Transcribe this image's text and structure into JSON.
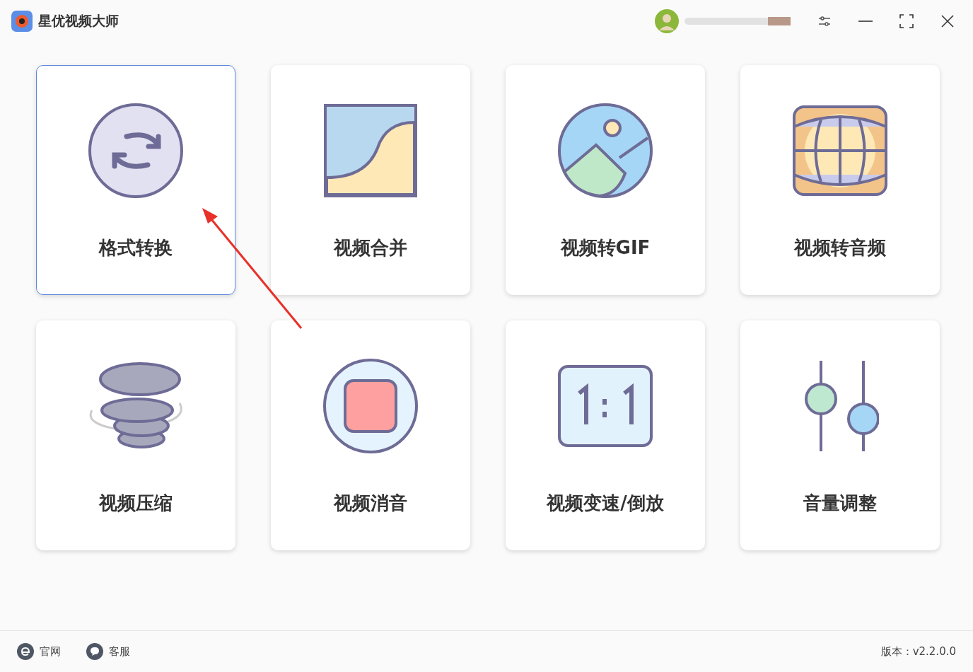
{
  "window": {
    "title": "星优视频大师"
  },
  "tools": [
    {
      "kind": "convert",
      "label": "格式转换",
      "selected": true
    },
    {
      "kind": "merge",
      "label": "视频合并",
      "selected": false
    },
    {
      "kind": "gif",
      "label": "视频转GIF",
      "selected": false
    },
    {
      "kind": "audio",
      "label": "视频转音频",
      "selected": false
    },
    {
      "kind": "compress",
      "label": "视频压缩",
      "selected": false
    },
    {
      "kind": "mute",
      "label": "视频消音",
      "selected": false
    },
    {
      "kind": "speed",
      "label": "视频变速/倒放",
      "selected": false
    },
    {
      "kind": "volume",
      "label": "音量调整",
      "selected": false
    }
  ],
  "footer": {
    "links": [
      {
        "kind": "web",
        "label": "官网"
      },
      {
        "kind": "chat",
        "label": "客服"
      }
    ],
    "version": "版本：v2.2.0.0"
  }
}
